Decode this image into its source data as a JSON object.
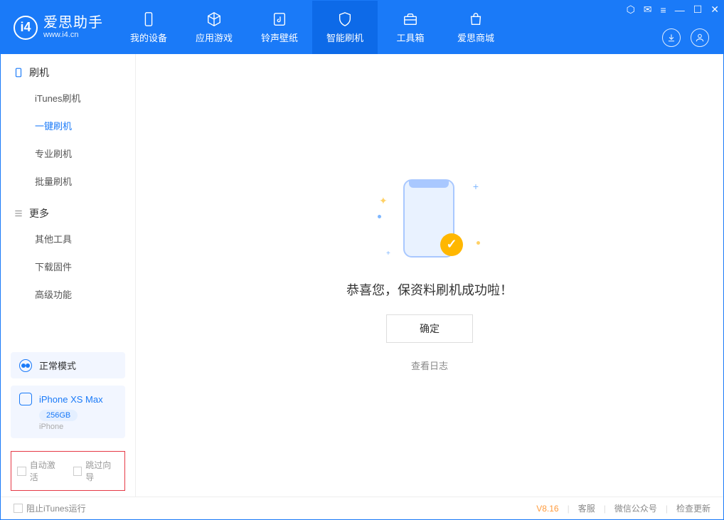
{
  "app": {
    "title": "爱思助手",
    "subtitle": "www.i4.cn"
  },
  "nav": {
    "tabs": [
      {
        "label": "我的设备"
      },
      {
        "label": "应用游戏"
      },
      {
        "label": "铃声壁纸"
      },
      {
        "label": "智能刷机"
      },
      {
        "label": "工具箱"
      },
      {
        "label": "爱思商城"
      }
    ],
    "active_index": 3
  },
  "sidebar": {
    "section1_title": "刷机",
    "items1": [
      {
        "label": "iTunes刷机"
      },
      {
        "label": "一键刷机"
      },
      {
        "label": "专业刷机"
      },
      {
        "label": "批量刷机"
      }
    ],
    "active_item1": 1,
    "section2_title": "更多",
    "items2": [
      {
        "label": "其他工具"
      },
      {
        "label": "下载固件"
      },
      {
        "label": "高级功能"
      }
    ],
    "status_label": "正常模式",
    "device_name": "iPhone XS Max",
    "device_capacity": "256GB",
    "device_type": "iPhone",
    "check1": "自动激活",
    "check2": "跳过向导"
  },
  "main": {
    "success_message": "恭喜您，保资料刷机成功啦！",
    "ok_button": "确定",
    "log_link": "查看日志"
  },
  "footer": {
    "block_itunes": "阻止iTunes运行",
    "version": "V8.16",
    "links": [
      "客服",
      "微信公众号",
      "检查更新"
    ]
  }
}
